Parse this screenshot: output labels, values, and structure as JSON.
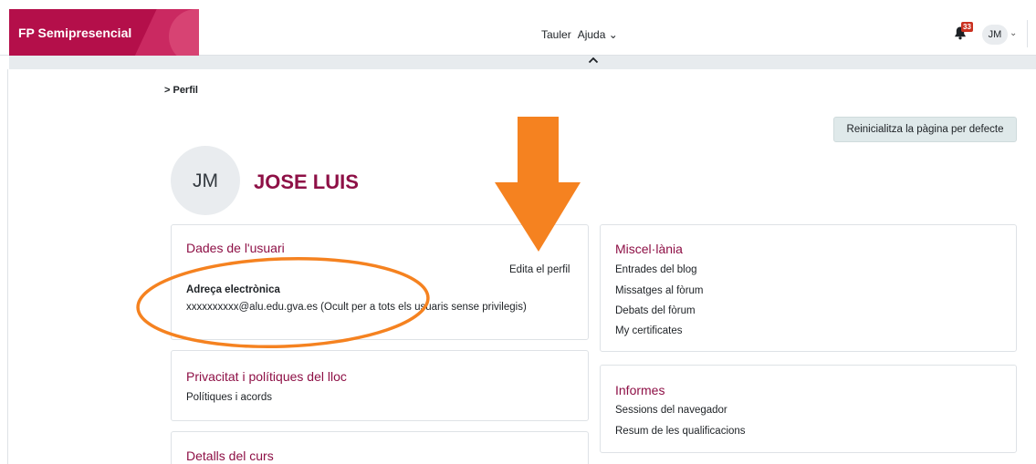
{
  "navbar": {
    "brand": "FP Semipresencial",
    "items": [
      {
        "label": "Tauler"
      },
      {
        "label": "Ajuda ⌄"
      }
    ],
    "notification_count": "33",
    "user_initials": "JM",
    "user_menu_caret": "⌄"
  },
  "breadcrumb": "> Perfil",
  "reset_button": "Reinicialitza la pàgina per defecte",
  "profile": {
    "initials": "JM",
    "name": "JOSE LUIS"
  },
  "cards": {
    "user_details": {
      "title": "Dades de l'usuari",
      "edit_link": "Edita el perfil",
      "email_label": "Adreça electrònica",
      "email_value": "xxxxxxxxxx@alu.edu.gva.es (Ocult per a tots els usuaris sense privilegis)"
    },
    "privacy": {
      "title": "Privacitat i polítiques del lloc",
      "items": [
        "Polítiques i acords"
      ]
    },
    "course_details": {
      "title": "Detalls del curs"
    },
    "misc": {
      "title": "Miscel·lània",
      "items": [
        "Entrades del blog",
        "Missatges al fòrum",
        "Debats del fòrum",
        "My certificates"
      ]
    },
    "reports": {
      "title": "Informes",
      "items": [
        "Sessions del navegador",
        "Resum de les qualificacions"
      ]
    }
  },
  "colors": {
    "brand": "#b40f4a",
    "title": "#8e1046",
    "annotation": "#f58220"
  }
}
